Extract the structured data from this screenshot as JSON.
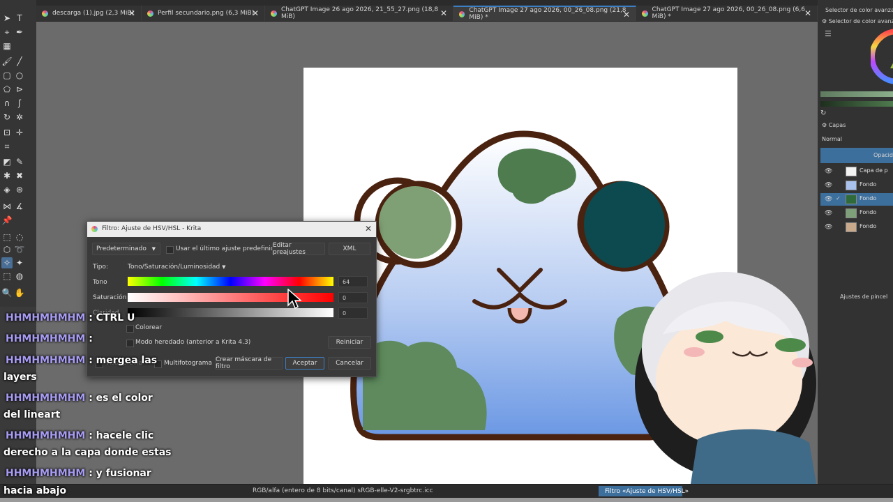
{
  "tabs": [
    {
      "label": "descarga (1).jpg (2,3 MiB)"
    },
    {
      "label": "Perfil secundario.png (6,3 MiB)"
    },
    {
      "label": "ChatGPT Image 26 ago 2026, 21_55_27.png (18,8 MiB)"
    },
    {
      "label": "ChatGPT Image 27 ago 2026, 00_26_08.png (21,8 MiB) *"
    },
    {
      "label": "ChatGPT Image 27 ago 2026, 00_26_08.png (6,6 MiB) *"
    }
  ],
  "dock": {
    "color_selector_header": "Selector de color avanzado",
    "color_selector_tab": "Selector de color avanzado",
    "layers_title": "Capas",
    "blend_mode": "Normal",
    "opacity_label": "Opacidad",
    "layers": [
      {
        "name": "Capa de p"
      },
      {
        "name": "Fondo"
      },
      {
        "name": "Fondo"
      },
      {
        "name": "Fondo"
      },
      {
        "name": "Fondo"
      }
    ],
    "brush_settings": "Ajustes de pincel"
  },
  "dialog": {
    "title": "Filtro: Ajuste de HSV/HSL - Krita",
    "preset": "Predeterminado",
    "use_last": "Usar el último ajuste predefinido",
    "edit_presets": "Editar preajustes",
    "xml": "XML",
    "type_label": "Tipo:",
    "type_value": "Tono/Saturación/Luminosidad",
    "hue_label": "Tono",
    "hue_value": "64",
    "sat_label": "Saturación",
    "sat_value": "0",
    "light_label": "Claridad",
    "light_value": "0",
    "colorize": "Colorear",
    "legacy_mode": "Modo heredado (anterior a Krita 4.3)",
    "reset": "Reiniciar",
    "preview": "Vista previa",
    "multiframe": "Multifotograma",
    "create_mask": "Crear máscara de filtro",
    "accept": "Aceptar",
    "cancel": "Cancelar"
  },
  "status": {
    "color_profile": "RGB/alfa (entero de 8 bits/canal)  sRGB-elle-V2-srgbtrc.icc",
    "filter_progress": "Filtro «Ajuste de HSV/HSL»"
  },
  "chat": [
    {
      "user": "HHMHMHMHM",
      "msg": ": CTRL U"
    },
    {
      "user": "HHMHMHMHM",
      "msg": ":"
    },
    {
      "user": "HHMHMHMHM",
      "msg": ": mergea las"
    },
    {
      "user": "",
      "msg": "layers"
    },
    {
      "user": "HHMHMHMHM",
      "msg": ": es el color"
    },
    {
      "user": "",
      "msg": "del lineart"
    },
    {
      "user": "HHMHMHMHM",
      "msg": ": hacele clic"
    },
    {
      "user": "",
      "msg": "derecho a la capa donde estas"
    },
    {
      "user": "HHMHMHMHM",
      "msg": ": y fusionar"
    },
    {
      "user": "",
      "msg": "hacia abajo"
    }
  ],
  "colors": {
    "selection": "#4a6f96",
    "accent_blue": "#3d7fc4",
    "chat_user": "#a79cf3"
  }
}
